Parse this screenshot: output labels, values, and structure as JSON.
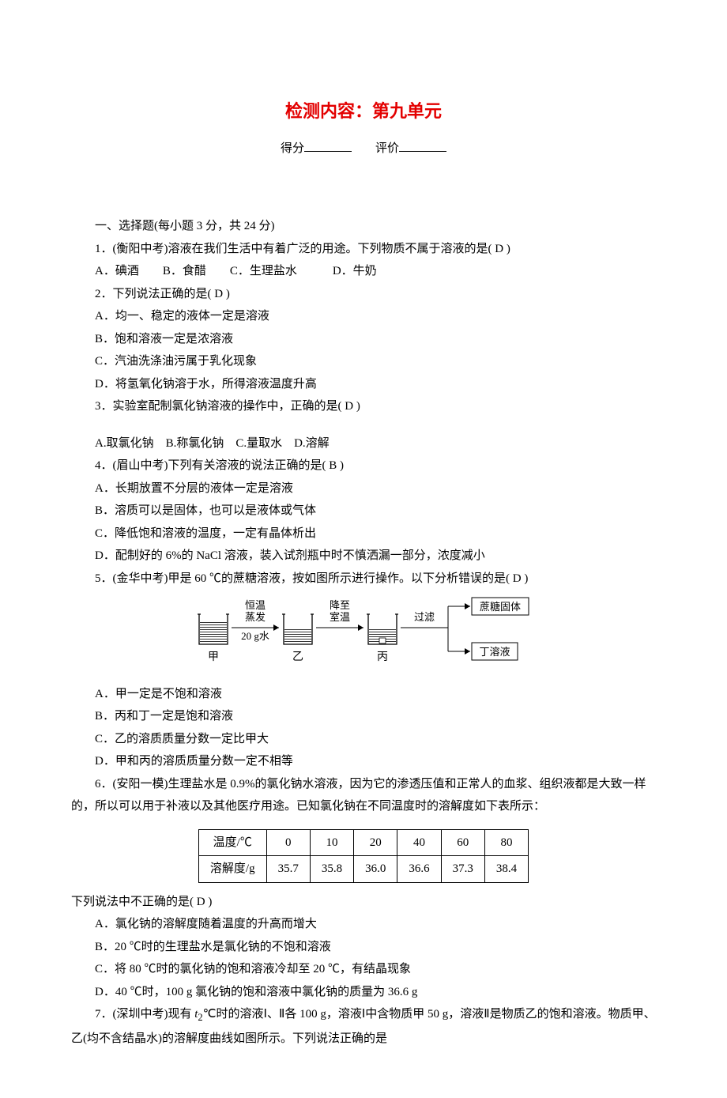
{
  "title": "检测内容：第九单元",
  "score_label": "得分",
  "eval_label": "评价",
  "section1_header": "一、选择题(每小题 3 分，共 24 分)",
  "q1": {
    "stem": "1．(衡阳中考)溶液在我们生活中有着广泛的用途。下列物质不属于溶液的是( D )",
    "options": "A．碘酒　　B．食醋　　C．生理盐水　　　D．牛奶"
  },
  "q2": {
    "stem": "2．下列说法正确的是( D )",
    "a": "A．均一、稳定的液体一定是溶液",
    "b": "B．饱和溶液一定是浓溶液",
    "c": "C．汽油洗涤油污属于乳化现象",
    "d": "D．将氢氧化钠溶于水，所得溶液温度升高"
  },
  "q3": {
    "stem": "3．实验室配制氯化钠溶液的操作中，正确的是( D )",
    "options": "A.取氯化钠　B.称氯化钠　C.量取水　D.溶解"
  },
  "q4": {
    "stem": "4．(眉山中考)下列有关溶液的说法正确的是( B )",
    "a": "A．长期放置不分层的液体一定是溶液",
    "b": "B．溶质可以是固体，也可以是液体或气体",
    "c": "C．降低饱和溶液的温度，一定有晶体析出",
    "d": "D．配制好的 6%的 NaCl 溶液，装入试剂瓶中时不慎洒漏一部分，浓度减小"
  },
  "q5": {
    "stem": "5．(金华中考)甲是 60 ℃的蔗糖溶液，按如图所示进行操作。以下分析错误的是( D )",
    "a": "A．甲一定是不饱和溶液",
    "b": "B．丙和丁一定是饱和溶液",
    "c": "C．乙的溶质质量分数一定比甲大",
    "d": "D．甲和丙的溶质质量分数一定不相等",
    "diag": {
      "jia": "甲",
      "yi": "乙",
      "bing": "丙",
      "op1a": "恒温",
      "op1b": "蒸发",
      "op1c": "20 g水",
      "op2a": "降至",
      "op2b": "室温",
      "filter": "过滤",
      "solid": "蔗糖固体",
      "ding": "丁溶液"
    }
  },
  "q6": {
    "intro": "6．(安阳一模)生理盐水是 0.9%的氯化钠水溶液，因为它的渗透压值和正常人的血浆、组织液都是大致一样的，所以可以用于补液以及其他医疗用途。已知氯化钠在不同温度时的溶解度如下表所示：",
    "after_table": "下列说法中不正确的是( D )",
    "a": "A．氯化钠的溶解度随着温度的升高而增大",
    "b": "B．20 ℃时的生理盐水是氯化钠的不饱和溶液",
    "c": "C．将 80 ℃时的氯化钠的饱和溶液冷却至 20 ℃，有结晶现象",
    "d": "D．40 ℃时，100 g 氯化钠的饱和溶液中氯化钠的质量为 36.6 g"
  },
  "q7": {
    "stem_part1": "7．(深圳中考)现有 ",
    "t2": "t",
    "t2sub": "2",
    "stem_part2": "℃时的溶液Ⅰ、Ⅱ各 100 g，溶液Ⅰ中含物质甲 50 g，溶液Ⅱ是物质乙的饱和溶液。物质甲、乙(均不含结晶水)的溶解度曲线如图所示。下列说法正确的是"
  },
  "chart_data": {
    "type": "table",
    "title": "氯化钠溶解度表",
    "headers": [
      "温度/℃",
      "0",
      "10",
      "20",
      "40",
      "60",
      "80"
    ],
    "row_label": "溶解度/g",
    "values": [
      "35.7",
      "35.8",
      "36.0",
      "36.6",
      "37.3",
      "38.4"
    ]
  }
}
